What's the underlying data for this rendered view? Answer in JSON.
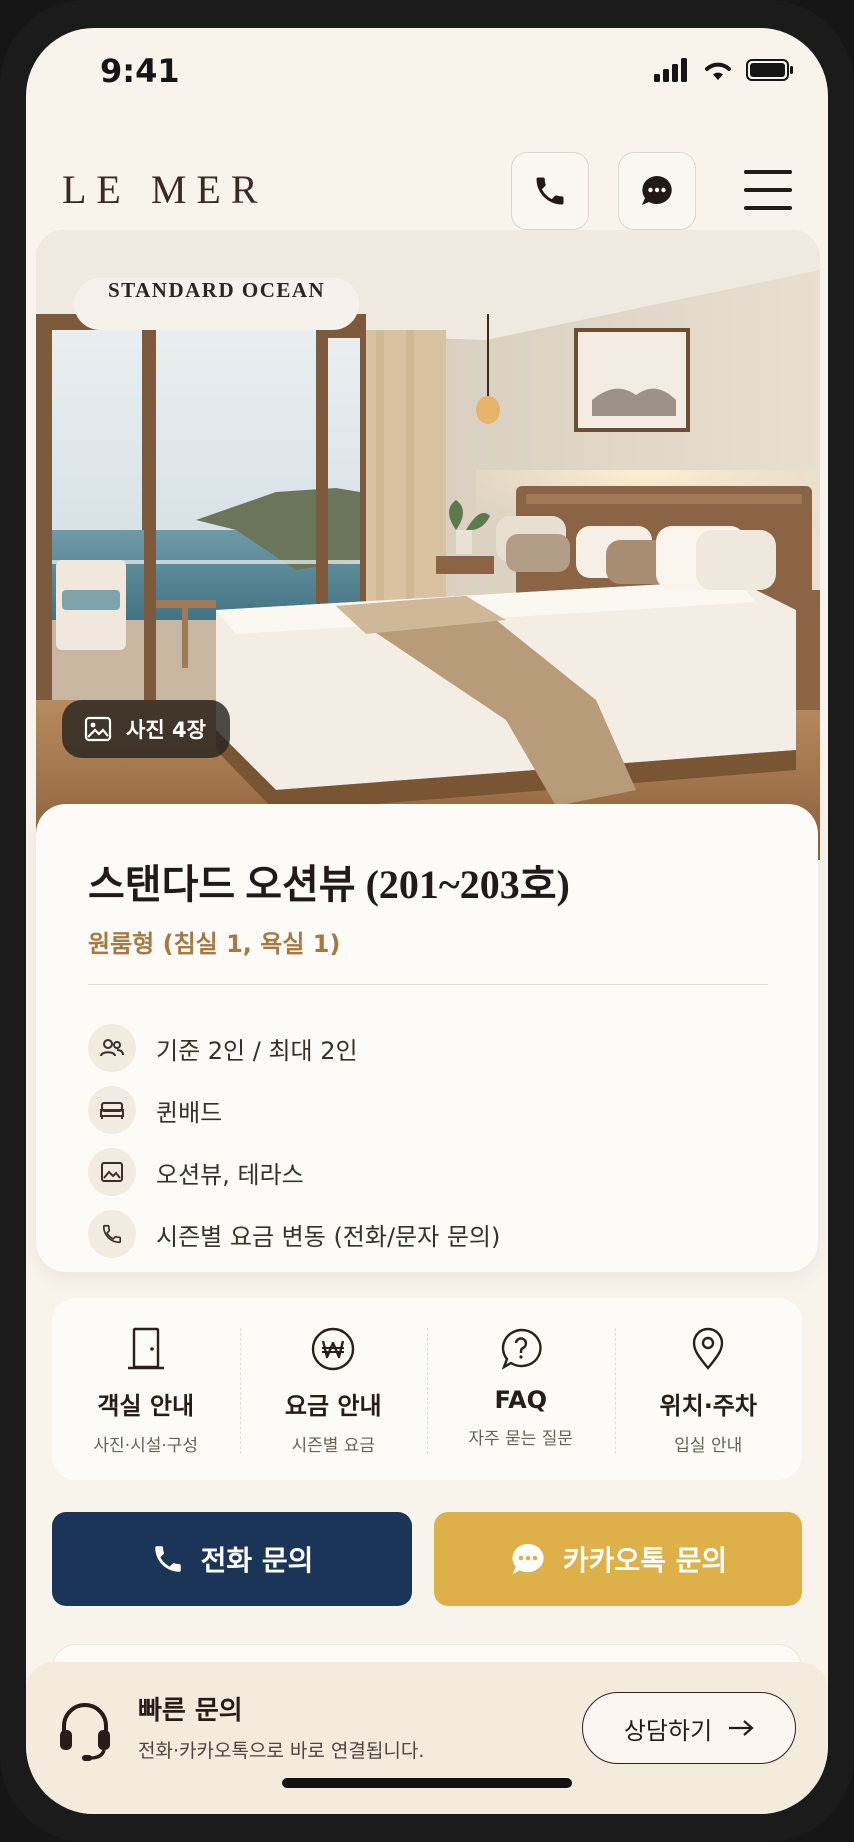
{
  "status": {
    "time": "9:41"
  },
  "header": {
    "logo": "LE MER"
  },
  "hero": {
    "badge": "STANDARD OCEAN",
    "photo_count": "사진 4장"
  },
  "room": {
    "title": "스탠다드 오션뷰 (201~203호)",
    "subtitle": "원룸형 (침실 1, 욕실 1)",
    "features": [
      {
        "icon": "users-icon",
        "text": "기준 2인 / 최대 2인"
      },
      {
        "icon": "bed-icon",
        "text": "퀸배드"
      },
      {
        "icon": "landscape-icon",
        "text": "오션뷰, 테라스"
      },
      {
        "icon": "phone-icon",
        "text": "시즌별 요금 변동 (전화/문자 문의)"
      }
    ]
  },
  "quick_nav": [
    {
      "icon": "door-icon",
      "label": "객실 안내",
      "sub": "사진·시설·구성"
    },
    {
      "icon": "won-icon",
      "label": "요금 안내",
      "sub": "시즌별 요금"
    },
    {
      "icon": "question-icon",
      "label": "FAQ",
      "sub": "자주 묻는 질문"
    },
    {
      "icon": "location-pin-icon",
      "label": "위치·주차",
      "sub": "입실 안내"
    }
  ],
  "cta": {
    "call": "전화 문의",
    "kakao": "카카오톡 문의"
  },
  "bottom": {
    "title": "빠른 문의",
    "subtitle": "전화·카카오톡으로 바로 연결됩니다.",
    "button": "상담하기"
  },
  "colors": {
    "navy": "#1b3558",
    "gold": "#ddb04a",
    "accent": "#a87842",
    "background": "#f8f4ec"
  }
}
